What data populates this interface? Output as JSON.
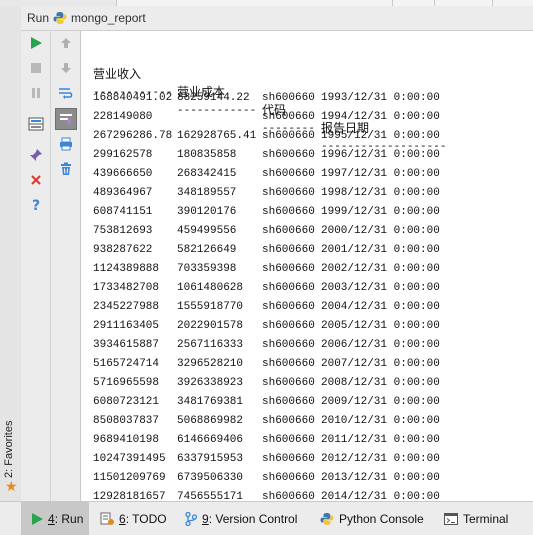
{
  "run_bar": {
    "label": "Run",
    "config_name": "mongo_report"
  },
  "left_sidebar": {
    "favorites_label": "2: Favorites"
  },
  "toolbar_primary": [
    {
      "name": "rerun-icon"
    },
    {
      "name": "stop-icon"
    },
    {
      "name": "pause-icon"
    },
    {
      "name": "layout-icon"
    },
    {
      "name": "pin-icon"
    },
    {
      "name": "close-icon"
    },
    {
      "name": "help-icon"
    }
  ],
  "toolbar_secondary": [
    {
      "name": "up-arrow-icon"
    },
    {
      "name": "down-arrow-icon"
    },
    {
      "name": "soft-wrap-icon"
    },
    {
      "name": "scroll-to-end-icon"
    },
    {
      "name": "print-icon"
    },
    {
      "name": "trash-icon"
    }
  ],
  "console": {
    "headers": [
      "营业收入",
      "营业成本",
      "代码",
      "报告日期"
    ],
    "separators": [
      "------------",
      "------------",
      "--------",
      "-------------------"
    ],
    "rows": [
      [
        "168840491.02",
        "88259144.22",
        "sh600660",
        "1993/12/31 0:00:00"
      ],
      [
        "228149080",
        "",
        "sh600660",
        "1994/12/31 0:00:00"
      ],
      [
        "267296286.78",
        "162928765.41",
        "sh600660",
        "1995/12/31 0:00:00"
      ],
      [
        "299162578",
        "180835858",
        "sh600660",
        "1996/12/31 0:00:00"
      ],
      [
        "439666650",
        "268342415",
        "sh600660",
        "1997/12/31 0:00:00"
      ],
      [
        "489364967",
        "348189557",
        "sh600660",
        "1998/12/31 0:00:00"
      ],
      [
        "608741151",
        "390120176",
        "sh600660",
        "1999/12/31 0:00:00"
      ],
      [
        "753812693",
        "459499556",
        "sh600660",
        "2000/12/31 0:00:00"
      ],
      [
        "938287622",
        "582126649",
        "sh600660",
        "2001/12/31 0:00:00"
      ],
      [
        "1124389888",
        "703359398",
        "sh600660",
        "2002/12/31 0:00:00"
      ],
      [
        "1733482708",
        "1061480628",
        "sh600660",
        "2003/12/31 0:00:00"
      ],
      [
        "2345227988",
        "1555918770",
        "sh600660",
        "2004/12/31 0:00:00"
      ],
      [
        "2911163405",
        "2022901578",
        "sh600660",
        "2005/12/31 0:00:00"
      ],
      [
        "3934615887",
        "2567116333",
        "sh600660",
        "2006/12/31 0:00:00"
      ],
      [
        "5165724714",
        "3296528210",
        "sh600660",
        "2007/12/31 0:00:00"
      ],
      [
        "5716965598",
        "3926338923",
        "sh600660",
        "2008/12/31 0:00:00"
      ],
      [
        "6080723121",
        "3481769381",
        "sh600660",
        "2009/12/31 0:00:00"
      ],
      [
        "8508037837",
        "5068869982",
        "sh600660",
        "2010/12/31 0:00:00"
      ],
      [
        "9689410198",
        "6146669406",
        "sh600660",
        "2011/12/31 0:00:00"
      ],
      [
        "10247391495",
        "6337915953",
        "sh600660",
        "2012/12/31 0:00:00"
      ],
      [
        "11501209769",
        "6739506330",
        "sh600660",
        "2013/12/31 0:00:00"
      ],
      [
        "12928181657",
        "7456555171",
        "sh600660",
        "2014/12/31 0:00:00"
      ]
    ]
  },
  "bottom_tabs": [
    {
      "mnemonic": "4",
      "label": ": Run",
      "icon": "run-icon",
      "selected": true
    },
    {
      "mnemonic": "6",
      "label": ": TODO",
      "icon": "todo-icon",
      "selected": false
    },
    {
      "mnemonic": "9",
      "label": ": Version Control",
      "icon": "vcs-icon",
      "selected": false
    },
    {
      "mnemonic": "",
      "label": "Python Console",
      "icon": "python-icon",
      "selected": false
    },
    {
      "mnemonic": "",
      "label": "Terminal",
      "icon": "terminal-icon",
      "selected": false
    }
  ],
  "colors": {
    "run_green": "#2aa24f",
    "stop_red": "#d9382e",
    "help_blue": "#3b86d6",
    "favorite_orange": "#e38a1a"
  }
}
